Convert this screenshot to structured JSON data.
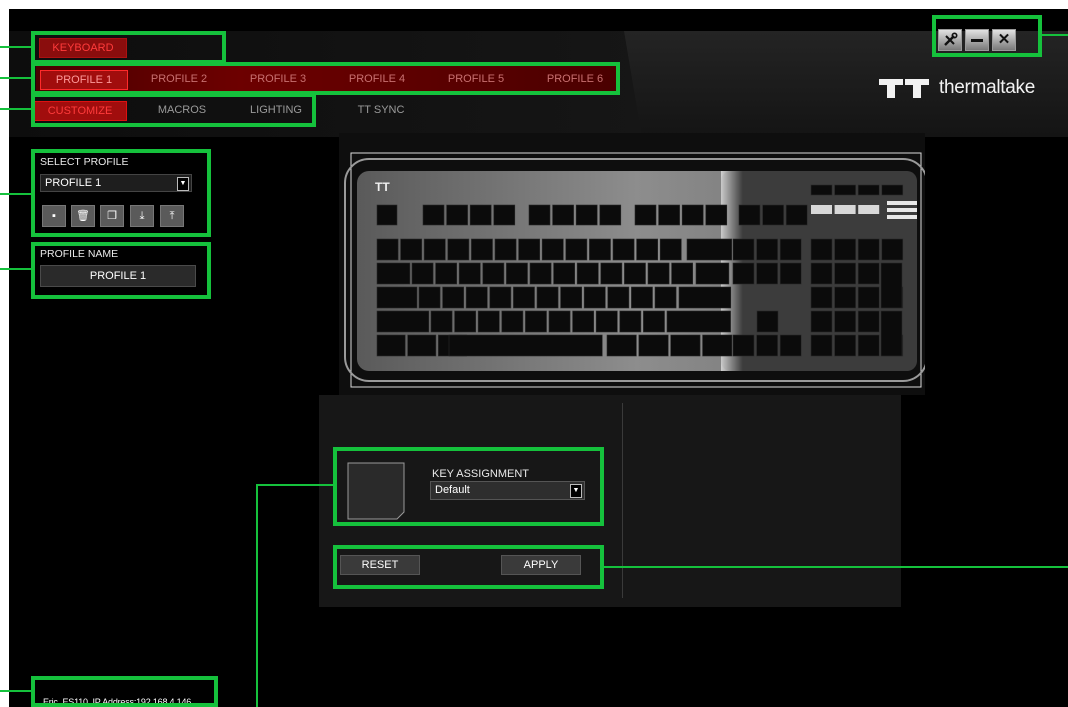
{
  "top": {
    "keyboard_tab": "KEYBOARD"
  },
  "profile_tabs": [
    "PROFILE 1",
    "PROFILE 2",
    "PROFILE 3",
    "PROFILE 4",
    "PROFILE 5",
    "PROFILE 6"
  ],
  "active_profile_tab": 0,
  "sub_tabs": [
    "CUSTOMIZE",
    "MACROS",
    "LIGHTING",
    "TT SYNC"
  ],
  "active_sub_tab": 0,
  "logo": {
    "word": "thermaltake",
    "mark": "TT"
  },
  "window_buttons": [
    {
      "icon": "wrench-screwdriver-icon",
      "glyph": "✕"
    },
    {
      "icon": "minimize-icon",
      "glyph": "—"
    },
    {
      "icon": "close-icon",
      "glyph": "✕"
    }
  ],
  "select_profile": {
    "label": "SELECT PROFILE",
    "value": "PROFILE 1",
    "actions": [
      {
        "icon": "new-profile-icon",
        "glyph": "▪"
      },
      {
        "icon": "delete-profile-icon",
        "glyph": "🗑"
      },
      {
        "icon": "copy-profile-icon",
        "glyph": "❐"
      },
      {
        "icon": "import-profile-icon",
        "glyph": "⤓"
      },
      {
        "icon": "export-profile-icon",
        "glyph": "⤒"
      }
    ]
  },
  "profile_name": {
    "label": "PROFILE NAME",
    "value": "PROFILE 1"
  },
  "key_assignment": {
    "label": "KEY ASSIGNMENT",
    "value": "Default"
  },
  "buttons": {
    "reset": "RESET",
    "apply": "APPLY"
  },
  "status": {
    "text": "Eric_ES110, IP Address:192.168.4.146"
  },
  "colors": {
    "highlight": "#15c13c",
    "accent_red": "#a10d0d",
    "accent_red_text": "#ff3b3b"
  }
}
